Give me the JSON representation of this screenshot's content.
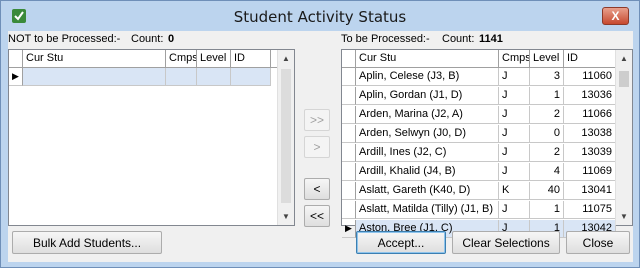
{
  "window": {
    "title": "Student Activity Status",
    "close_label": "X"
  },
  "not_processed": {
    "label": "NOT to be Processed:-",
    "count_label": "Count:",
    "count": "0",
    "columns": [
      "Cur Stu",
      "Cmps",
      "Level",
      "ID"
    ]
  },
  "to_process": {
    "label": "To be Processed:-",
    "count_label": "Count:",
    "count": "1141",
    "columns": [
      "Cur Stu",
      "Cmps",
      "Level",
      "ID"
    ],
    "rows": [
      {
        "name": "Aplin, Celese (J3, B)",
        "cmps": "J",
        "level": "3",
        "id": "11060"
      },
      {
        "name": "Aplin, Gordan (J1, D)",
        "cmps": "J",
        "level": "1",
        "id": "13036"
      },
      {
        "name": "Arden, Marina (J2, A)",
        "cmps": "J",
        "level": "2",
        "id": "11066"
      },
      {
        "name": "Arden, Selwyn (J0, D)",
        "cmps": "J",
        "level": "0",
        "id": "13038"
      },
      {
        "name": "Ardill, Ines (J2, C)",
        "cmps": "J",
        "level": "2",
        "id": "13039"
      },
      {
        "name": "Ardill, Khalid (J4, B)",
        "cmps": "J",
        "level": "4",
        "id": "11069"
      },
      {
        "name": "Aslatt, Gareth (K40, D)",
        "cmps": "K",
        "level": "40",
        "id": "13041"
      },
      {
        "name": "Aslatt, Matilda (Tilly) (J1, B)",
        "cmps": "J",
        "level": "1",
        "id": "11075"
      },
      {
        "name": "Aston, Bree (J1, C)",
        "cmps": "J",
        "level": "1",
        "id": "13042"
      }
    ]
  },
  "transfer": {
    "move_all_right": ">>",
    "move_right": ">",
    "move_left": "<",
    "move_all_left": "<<"
  },
  "buttons": {
    "bulk_add": "Bulk Add Students...",
    "accept": "Accept...",
    "clear": "Clear Selections",
    "close": "Close"
  }
}
